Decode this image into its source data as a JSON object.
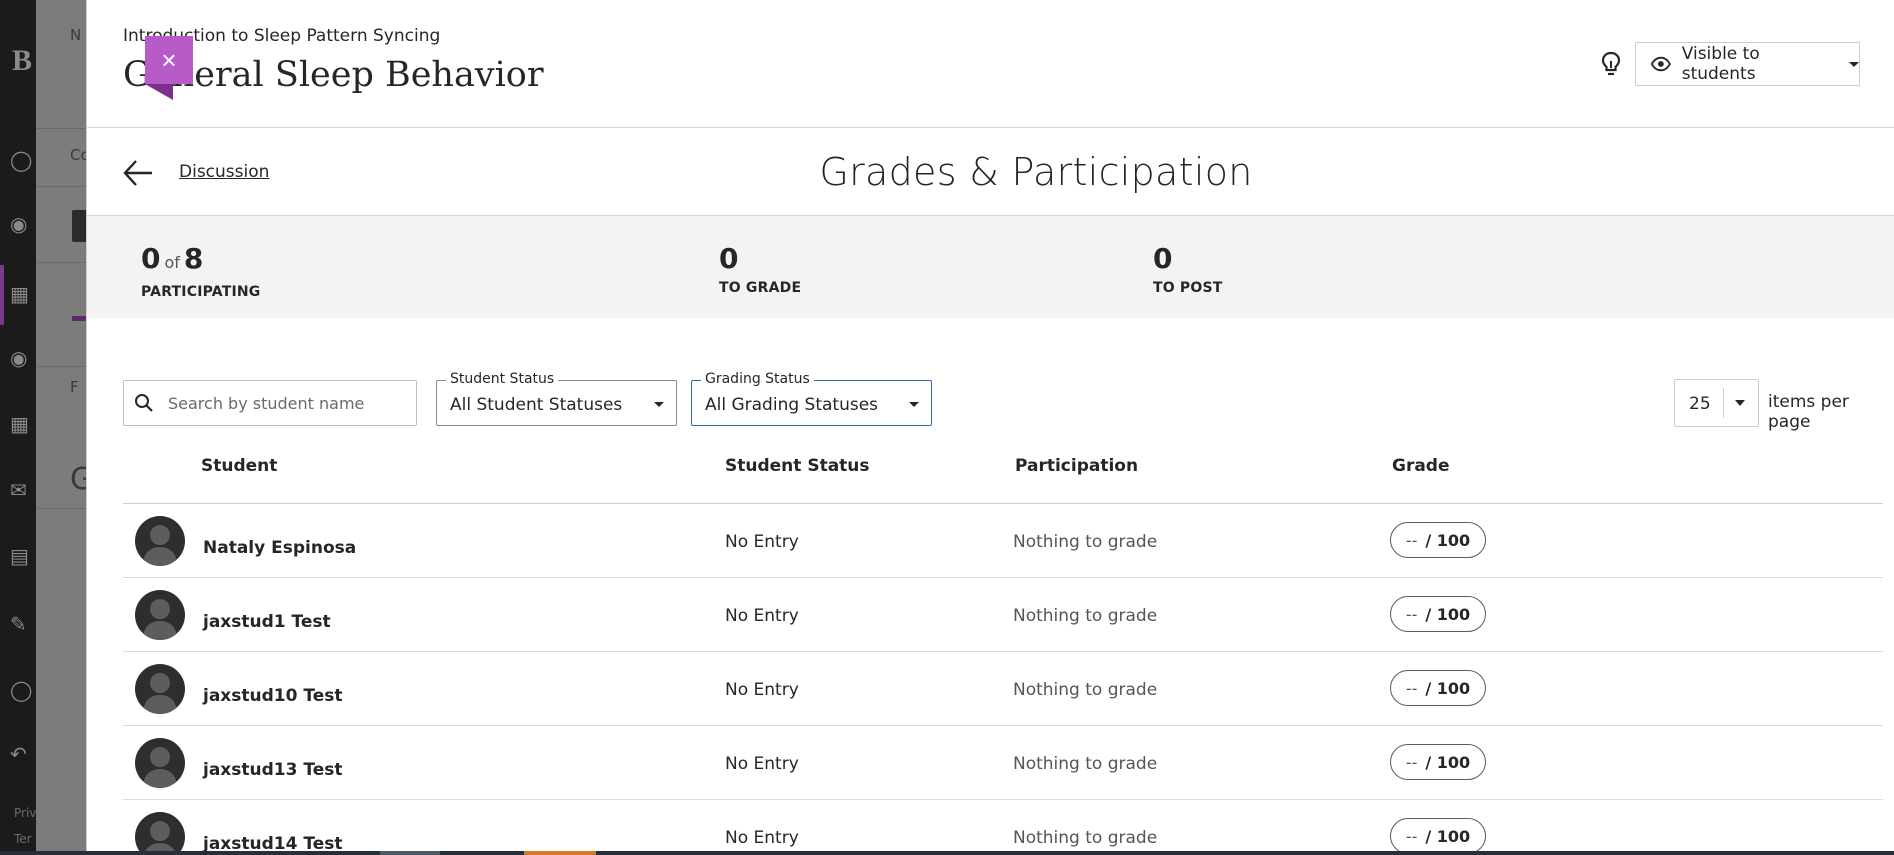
{
  "background": {
    "logo_letter": "B",
    "content_letters": [
      "N",
      "Co",
      "F",
      "G"
    ],
    "footer": [
      "Priv",
      "Ter"
    ]
  },
  "header": {
    "course_title": "Introduction to Sleep Pattern Syncing",
    "page_heading": "General Sleep Behavior",
    "close_symbol": "×",
    "visibility_label": "Visible to students"
  },
  "subheader": {
    "back_label": "Discussion",
    "title": "Grades & Participation"
  },
  "stats": {
    "participating": {
      "count": "0",
      "of_label": "of",
      "total": "8",
      "label": "PARTICIPATING"
    },
    "to_grade": {
      "count": "0",
      "label": "TO GRADE"
    },
    "to_post": {
      "count": "0",
      "label": "TO POST"
    }
  },
  "filters": {
    "search_placeholder": "Search by student name",
    "student_status": {
      "legend": "Student Status",
      "value": "All Student Statuses"
    },
    "grading_status": {
      "legend": "Grading Status",
      "value": "All Grading Statuses"
    },
    "per_page": {
      "value": "25",
      "label": "items per page"
    }
  },
  "table": {
    "headers": [
      "Student",
      "Student Status",
      "Participation",
      "Grade"
    ],
    "rows": [
      {
        "name": "Nataly Espinosa",
        "status": "No Entry",
        "participation": "Nothing to grade",
        "grade": "--",
        "max": "/ 100"
      },
      {
        "name": "jaxstud1 Test",
        "status": "No Entry",
        "participation": "Nothing to grade",
        "grade": "--",
        "max": "/ 100"
      },
      {
        "name": "jaxstud10 Test",
        "status": "No Entry",
        "participation": "Nothing to grade",
        "grade": "--",
        "max": "/ 100"
      },
      {
        "name": "jaxstud13 Test",
        "status": "No Entry",
        "participation": "Nothing to grade",
        "grade": "--",
        "max": "/ 100"
      },
      {
        "name": "jaxstud14 Test",
        "status": "No Entry",
        "participation": "Nothing to grade",
        "grade": "--",
        "max": "/ 100"
      }
    ]
  },
  "colors": {
    "close_accent": "#b75bc9",
    "focus_border": "#2a6ab0",
    "stats_background": "#f3f3f3"
  },
  "icons": [
    "close-icon",
    "lightbulb-icon",
    "eye-icon",
    "chevron-down-icon",
    "back-arrow-icon",
    "search-icon",
    "avatar-icon"
  ]
}
